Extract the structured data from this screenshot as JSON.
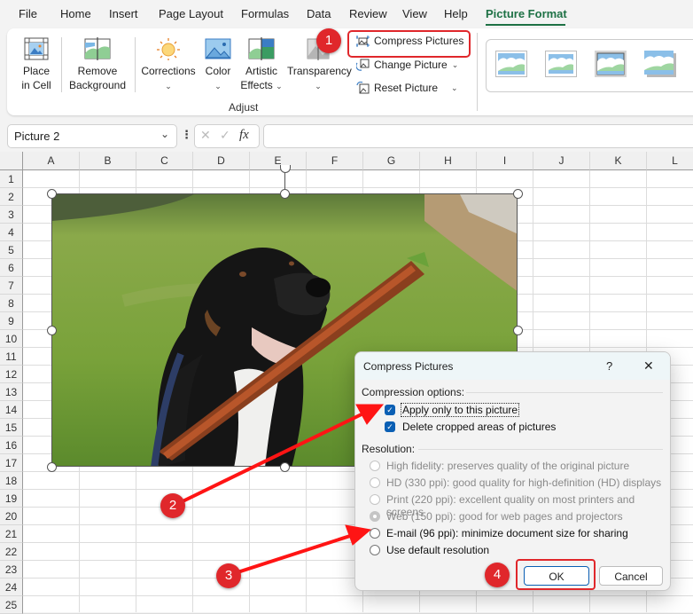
{
  "menubar": {
    "items": [
      "File",
      "Home",
      "Insert",
      "Page Layout",
      "Formulas",
      "Data",
      "Review",
      "View",
      "Help",
      "Picture Format"
    ],
    "active": "Picture Format"
  },
  "ribbon": {
    "place_in_cell": [
      "Place",
      "in Cell"
    ],
    "remove_background": [
      "Remove",
      "Background"
    ],
    "corrections": "Corrections",
    "color": "Color",
    "artistic_effects": [
      "Artistic",
      "Effects"
    ],
    "transparency": "Transparency",
    "compress_pictures": "Compress Pictures",
    "change_picture": "Change Picture",
    "reset_picture": "Reset Picture",
    "group_label": "Adjust",
    "picture_styles_count": 4
  },
  "formula_bar": {
    "name_box": "Picture 2",
    "fx_label": "fx",
    "formula_value": ""
  },
  "sheet": {
    "columns": [
      "A",
      "B",
      "C",
      "D",
      "E",
      "F",
      "G",
      "H",
      "I",
      "J",
      "K",
      "L"
    ],
    "rows": [
      "1",
      "2",
      "3",
      "4",
      "5",
      "6",
      "7",
      "8",
      "9",
      "10",
      "11",
      "12",
      "13",
      "14",
      "15",
      "16",
      "17",
      "18",
      "19",
      "20",
      "21",
      "22",
      "23",
      "24",
      "25"
    ],
    "picture_description": "Black and white dog holding a stick in its mouth on grass"
  },
  "dialog": {
    "title": "Compress Pictures",
    "help_label": "?",
    "close_label": "✕",
    "compression_section": "Compression options:",
    "apply_only": {
      "label": "Apply only to this picture",
      "checked": true
    },
    "delete_cropped": {
      "label": "Delete cropped areas of pictures",
      "checked": true
    },
    "resolution_section": "Resolution:",
    "resolution_options": [
      {
        "label": "High fidelity: preserves quality of the original picture",
        "enabled": false,
        "selected": false
      },
      {
        "label": "HD (330 ppi): good quality for high-definition (HD) displays",
        "enabled": false,
        "selected": false
      },
      {
        "label": "Print (220 ppi): excellent quality on most printers and screens",
        "enabled": false,
        "selected": false
      },
      {
        "label": "Web (150 ppi): good for web pages and projectors",
        "enabled": false,
        "selected": true
      },
      {
        "label": "E-mail (96 ppi): minimize document size for sharing",
        "enabled": true,
        "selected": false
      },
      {
        "label": "Use default resolution",
        "enabled": true,
        "selected": false
      }
    ],
    "ok_label": "OK",
    "cancel_label": "Cancel"
  },
  "callouts": [
    "1",
    "2",
    "3",
    "4"
  ],
  "colors": {
    "accent_green": "#1e7145",
    "callout_red": "#e0272b",
    "checkbox_blue": "#0a5fb4"
  }
}
